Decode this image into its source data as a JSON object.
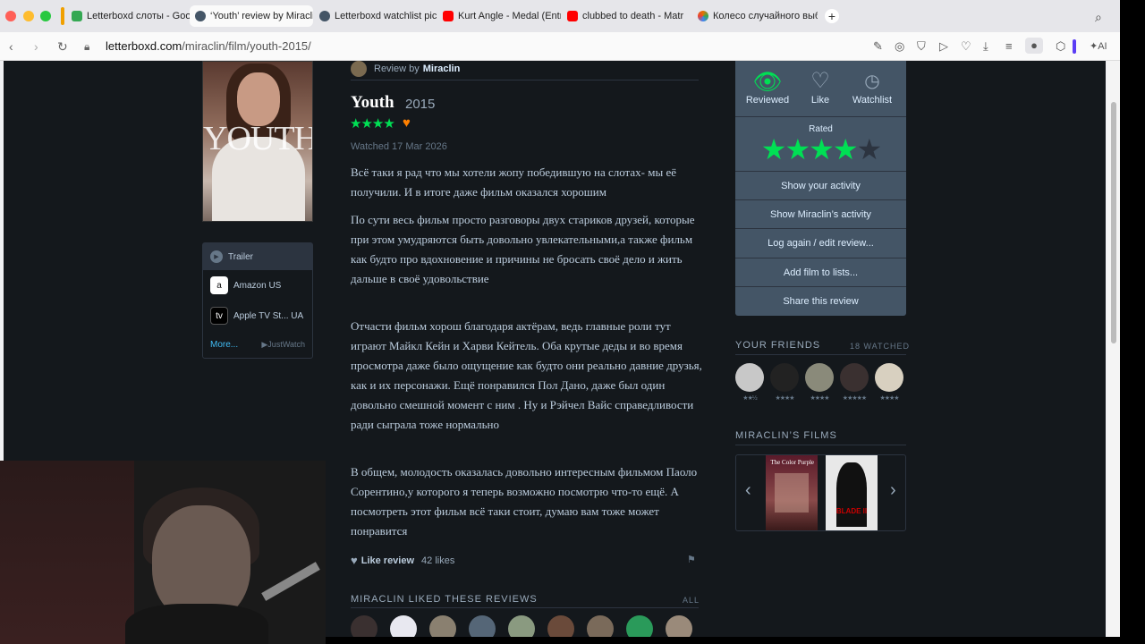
{
  "browser": {
    "tabs": [
      {
        "title": "Letterboxd слоты - Goog",
        "active": false,
        "color": "#34a853"
      },
      {
        "title": "‘Youth’ review by Miraclin",
        "active": true,
        "color": "#445566"
      },
      {
        "title": "Letterboxd watchlist pic",
        "active": false,
        "color": "#445566"
      },
      {
        "title": "Kurt Angle - Medal (Entr",
        "active": false,
        "color": "#ff0000"
      },
      {
        "title": "clubbed to death - Matr",
        "active": false,
        "color": "#ff0000"
      },
      {
        "title": "Колесо случайного выб",
        "active": false,
        "color": "#e37400"
      }
    ],
    "new_tab": "+",
    "url_host": "letterboxd.com",
    "url_path": "/miraclin/film/youth-2015/",
    "ai_label": "AI"
  },
  "sidebar": {
    "poster_title": "YOUTH",
    "trailer": "Trailer",
    "services": [
      {
        "name": "Amazon US",
        "icon": "amazon-icon"
      },
      {
        "name": "Apple TV St...  UA",
        "icon": "apple-tv-icon"
      }
    ],
    "more": "More...",
    "justwatch": "▶JustWatch"
  },
  "review": {
    "review_by_label": "Review by",
    "author": "Miraclin",
    "film_title": "Youth",
    "year": "2015",
    "stars": "★★★★",
    "liked": true,
    "watched": "Watched 17 Mar 2026",
    "rating_stars": 4,
    "paragraphs": [
      "Всё таки я рад что мы хотели жопу победившую на слотах- мы её получили. И в итоге даже фильм оказался хорошим",
      "По сути весь фильм просто разговоры двух стариков друзей, которые при этом умудряются быть довольно увлекательными,а также фильм как будто про вдохновение и причины не бросать своё дело и жить дальше в своё удовольствие",
      "Отчасти фильм хорош благодаря актёрам, ведь главные роли тут играют Майкл Кейн и Харви Кейтель. Оба крутые деды и во время просмотра даже было ощущение как будто они реально давние друзья, как и их персонажи. Ещё понравился Пол Дано, даже был один довольно смешной момент с ним . Ну и Рэйчел Вайс справедливости ради сыграла тоже нормально",
      "В общем, молодость оказалась довольно интересным фильмом Паоло Сорентино,у которого я теперь возможно посмотрю что-то ещё. А посмотреть этот фильм всё таки стоит, думаю вам тоже может понравится"
    ],
    "like_review": "Like review",
    "likes_count": "42 likes",
    "liked_reviews_heading": "MIRACLIN LIKED THESE REVIEWS",
    "liked_reviews_all": "ALL"
  },
  "actions": {
    "reviewed": "Reviewed",
    "like": "Like",
    "watchlist": "Watchlist",
    "rated_label": "Rated",
    "rated_value": 4,
    "buttons": [
      "Show your activity",
      "Show Miraclin’s activity",
      "Log again / edit review...",
      "Add film to lists...",
      "Share this review"
    ]
  },
  "friends": {
    "heading": "YOUR FRIENDS",
    "count": "18 WATCHED",
    "ratings": [
      "★★½",
      "★★★★",
      "★★★★",
      "★★★★★",
      "★★★★"
    ]
  },
  "miraclin_films": {
    "heading": "MIRACLIN’S FILMS",
    "posters": [
      "The Color Purple",
      "BLADE II"
    ]
  }
}
